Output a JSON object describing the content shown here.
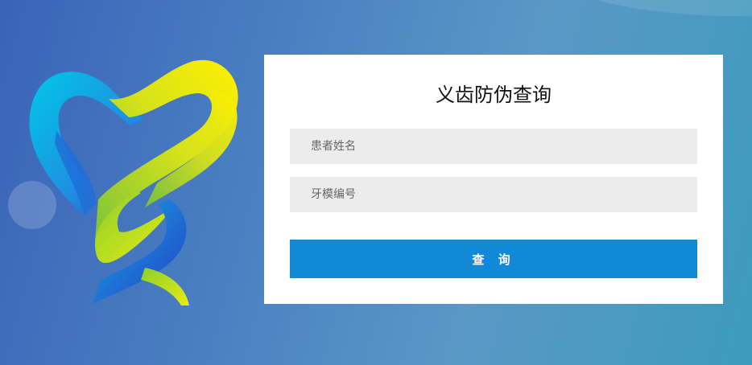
{
  "form": {
    "title": "义齿防伪查询",
    "patient_name_placeholder": "患者姓名",
    "mold_number_placeholder": "牙模编号",
    "submit_label": "查 询"
  },
  "colors": {
    "background": "#4a80c2",
    "card": "#ffffff",
    "input_bg": "#ececec",
    "button": "#1189d6",
    "logo_yellow": "#f2ea00",
    "logo_cyan": "#00c3e6",
    "logo_blue": "#2a4fd0"
  },
  "logo": {
    "icon": "heart-ribbon-logo-icon"
  }
}
